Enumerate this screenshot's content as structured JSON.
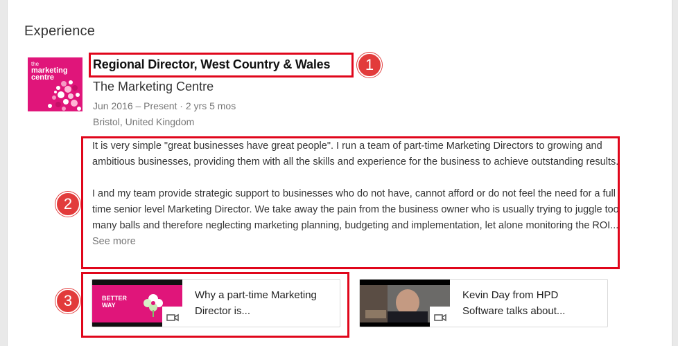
{
  "section": {
    "title": "Experience"
  },
  "logo": {
    "small_text": "the",
    "name_line1": "marketing",
    "name_line2": "centre"
  },
  "job": {
    "title": "Regional Director, West Country & Wales",
    "company": "The Marketing Centre",
    "dates": "Jun 2016 – Present · 2 yrs 5 mos",
    "location": "Bristol, United Kingdom"
  },
  "description": {
    "paragraph1": "It is very simple \"great businesses have great people\". I run a team of part-time Marketing Directors to growing and ambitious businesses, providing them with all the skills and experience for the business to achieve outstanding results.",
    "paragraph2": "I and my team provide strategic support to businesses who do not have, cannot afford or do not feel the need for a full time senior level Marketing Director. We take away the pain from the business owner who is usually trying to juggle too many balls and therefore neglecting marketing planning, budgeting and implementation, let alone monitoring the ROI...",
    "see_more": "See more"
  },
  "media": [
    {
      "title": "Why a part-time Marketing Director is...",
      "thumb_text": "BETTER WAY",
      "icon": "video-camera-icon"
    },
    {
      "title": "Kevin Day from HPD Software talks about...",
      "icon": "video-camera-icon"
    }
  ],
  "annotations": [
    {
      "label": "1"
    },
    {
      "label": "2"
    },
    {
      "label": "3"
    }
  ],
  "colors": {
    "accent_red": "#e0061b",
    "badge_red": "#e23b3b",
    "brand_pink": "#e0157a"
  }
}
